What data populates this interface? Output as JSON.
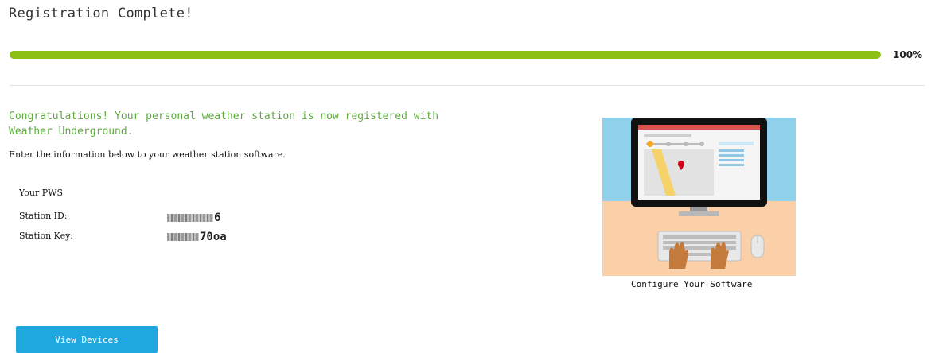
{
  "header": {
    "title": "Registration Complete!"
  },
  "progress": {
    "fraction": 1.0,
    "label": "100%",
    "color": "#8cc014"
  },
  "message": {
    "congrats": "Congratulations! Your personal weather station is now registered with Weather Underground.",
    "instruction": "Enter the information below to your weather station software."
  },
  "credentials": {
    "heading": "Your PWS",
    "station_id": {
      "label": "Station ID:",
      "value_visible_suffix": "6"
    },
    "station_key": {
      "label": "Station Key:",
      "value_visible_suffix": "70oa"
    }
  },
  "illustration": {
    "caption": "Configure Your Software",
    "icon": "computer-setup-illustration"
  },
  "actions": {
    "view_devices": "View Devices",
    "button_color": "#1fa8e0"
  }
}
